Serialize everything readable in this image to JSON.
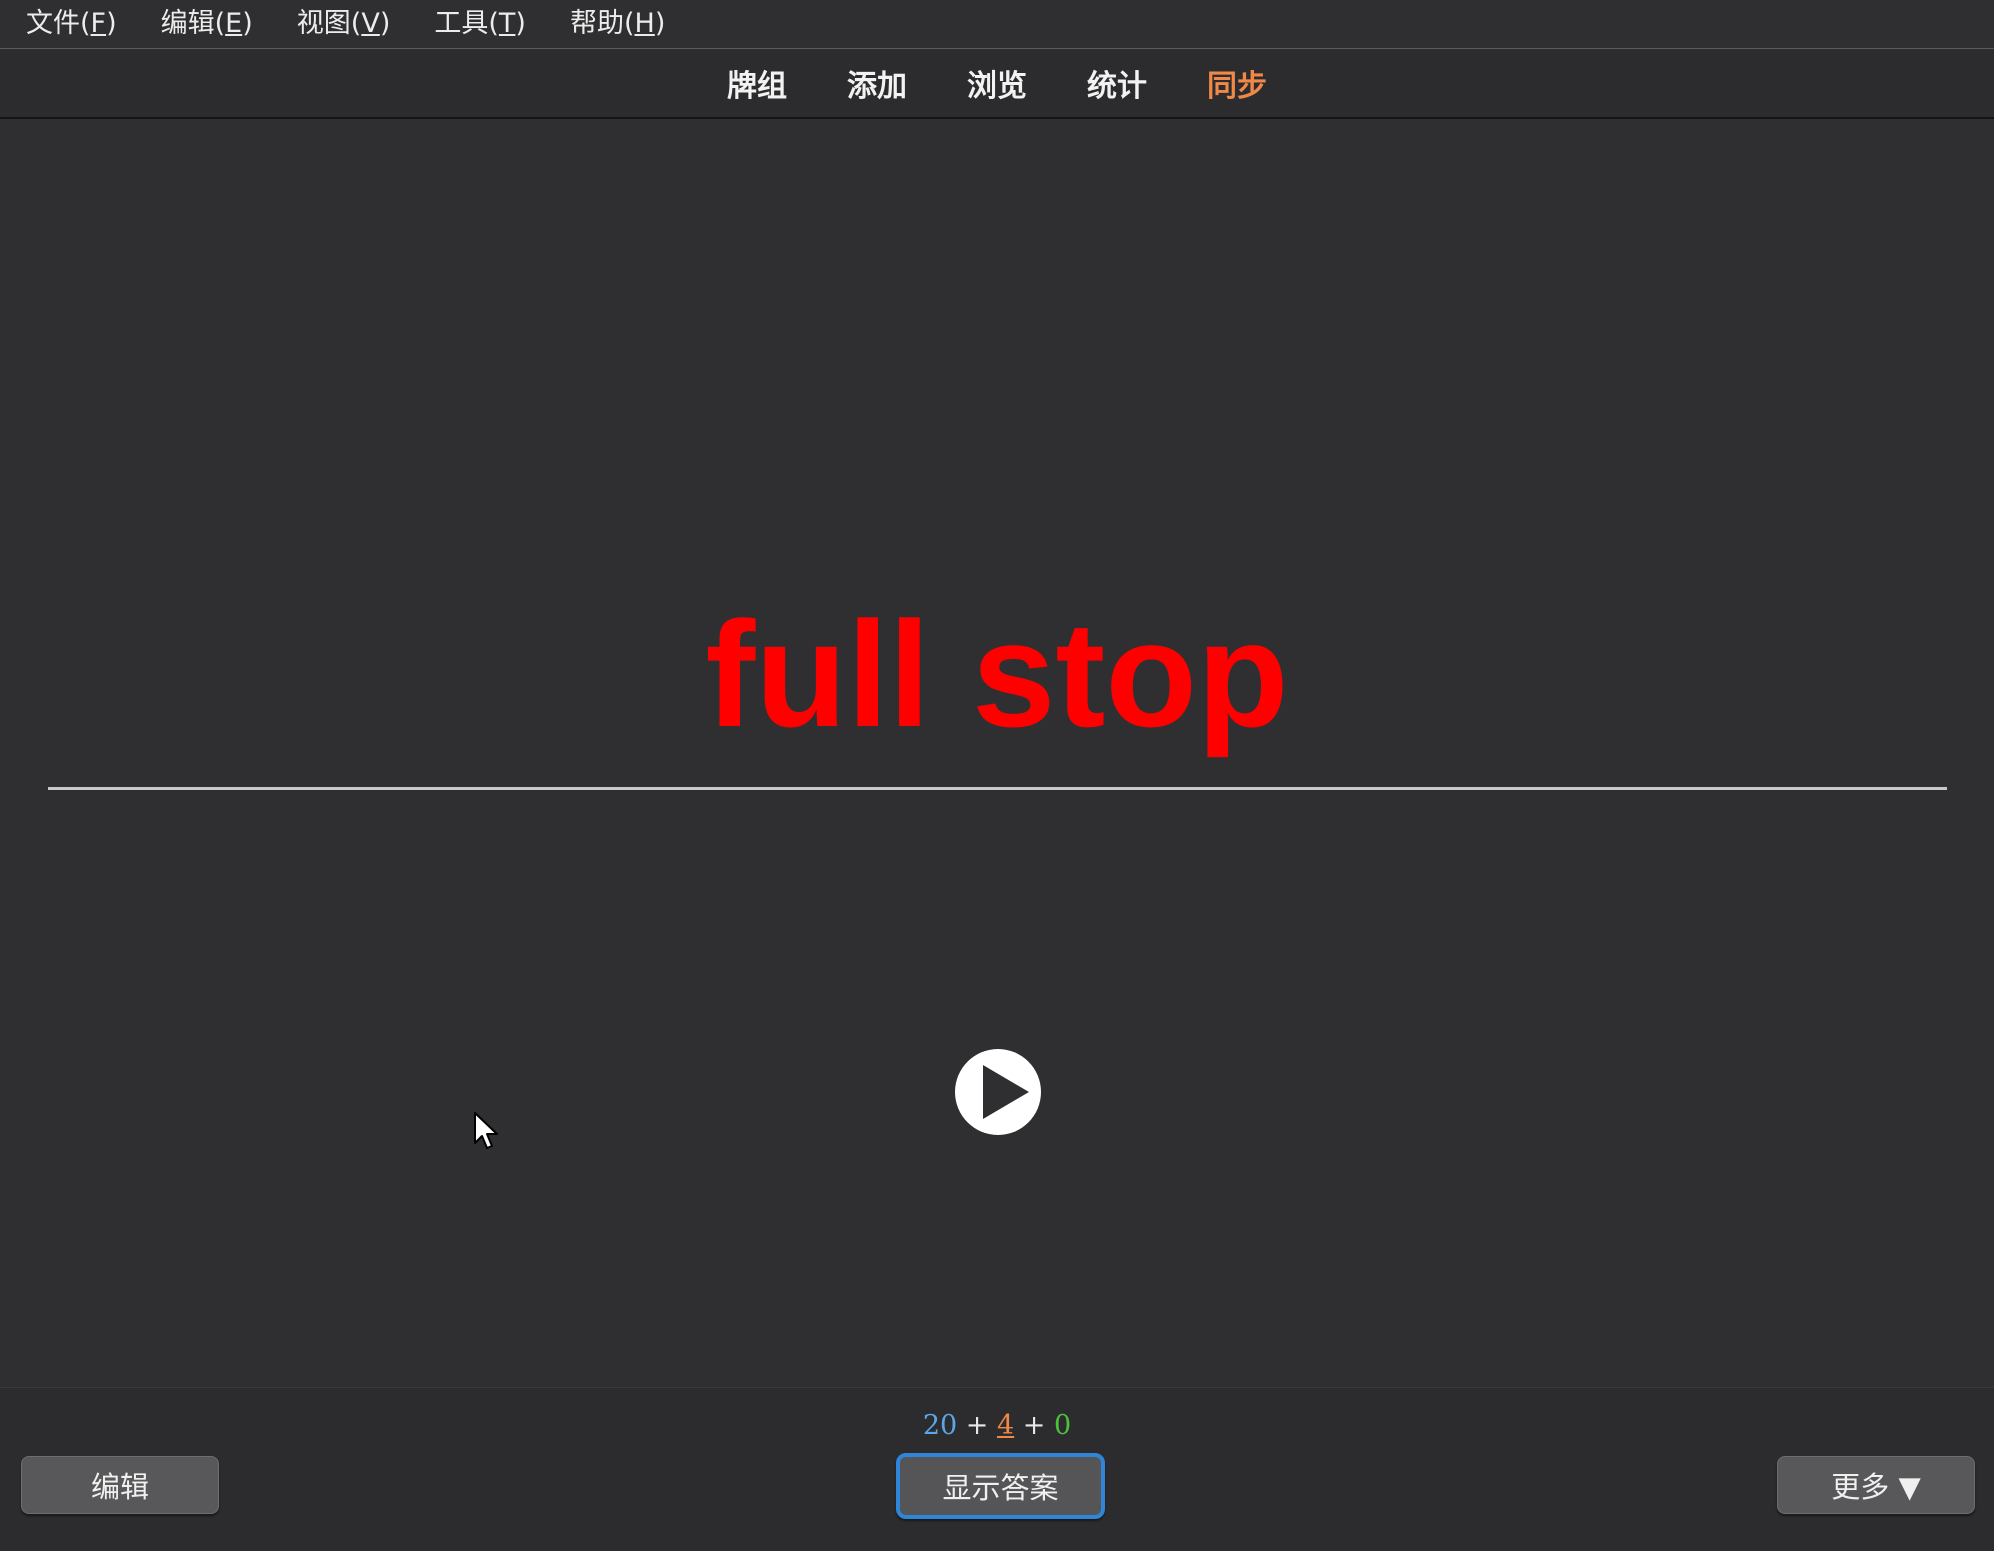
{
  "menu": [
    {
      "prefix": "文件(",
      "accel": "F",
      "suffix": ")"
    },
    {
      "prefix": "编辑(",
      "accel": "E",
      "suffix": ")"
    },
    {
      "prefix": "视图(",
      "accel": "V",
      "suffix": ")"
    },
    {
      "prefix": "工具(",
      "accel": "T",
      "suffix": ")"
    },
    {
      "prefix": "帮助(",
      "accel": "H",
      "suffix": ")"
    }
  ],
  "toolbar": {
    "decks": "牌组",
    "add": "添加",
    "browse": "浏览",
    "stats": "统计",
    "sync": "同步"
  },
  "card": {
    "question": "full stop",
    "audio_icon": "play-icon"
  },
  "counts": {
    "new": "20",
    "plus1": " + ",
    "learn": "4",
    "plus2": " + ",
    "review": "0"
  },
  "buttons": {
    "edit": "编辑",
    "show_answer": "显示答案",
    "more": "更多 ▼"
  },
  "colors": {
    "question": "#ff0000",
    "sync_active": "#f08848",
    "new_count": "#5aa6e8",
    "learn_count": "#f08848",
    "review_count": "#4cc23a",
    "focus_ring": "#2f86d8"
  }
}
